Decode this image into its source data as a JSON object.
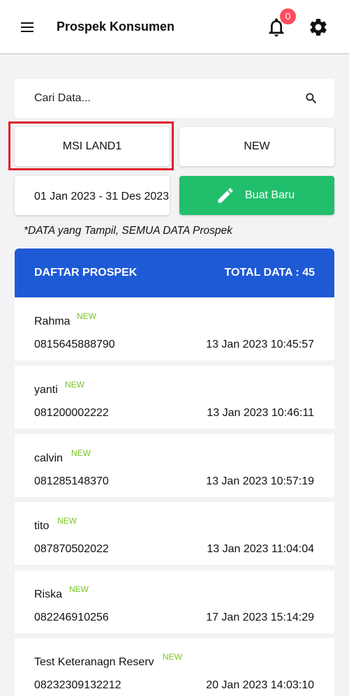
{
  "header": {
    "title": "Prospek Konsumen",
    "notification_count": "0",
    "menu_icon": "menu-icon",
    "bell_icon": "bell-icon",
    "settings_icon": "gear-icon"
  },
  "search": {
    "placeholder": "Cari Data..."
  },
  "filters": {
    "project": "MSI LAND1",
    "status": "NEW",
    "date_range": "01 Jan 2023 - 31 Des 2023",
    "create_button": "Buat Baru"
  },
  "note": "*DATA yang Tampil, SEMUA DATA Prospek",
  "list": {
    "title": "DAFTAR PROSPEK",
    "total": "TOTAL DATA : 45",
    "items": [
      {
        "name": "Rahma",
        "badge": "NEW",
        "phone": "0815645888790",
        "date": "13 Jan 2023 10:45:57"
      },
      {
        "name": "yanti",
        "badge": "NEW",
        "phone": "081200002222",
        "date": "13 Jan 2023 10:46:11"
      },
      {
        "name": "calvin",
        "badge": "NEW",
        "phone": "081285148370",
        "date": "13 Jan 2023 10:57:19"
      },
      {
        "name": "tito",
        "badge": "NEW",
        "phone": "087870502022",
        "date": "13 Jan 2023 11:04:04"
      },
      {
        "name": "Riska",
        "badge": "NEW",
        "phone": "082246910256",
        "date": "17 Jan 2023 15:14:29"
      },
      {
        "name": "Test Keteranagn Reserv",
        "badge": "NEW",
        "phone": "08232309132212",
        "date": "20 Jan 2023 14:03:10"
      }
    ]
  },
  "colors": {
    "accent_blue": "#1f5ad6",
    "button_green": "#21bf6b",
    "badge_red": "#ff4d5e",
    "new_label_green": "#78c71f",
    "highlight_red": "#e0202a"
  }
}
